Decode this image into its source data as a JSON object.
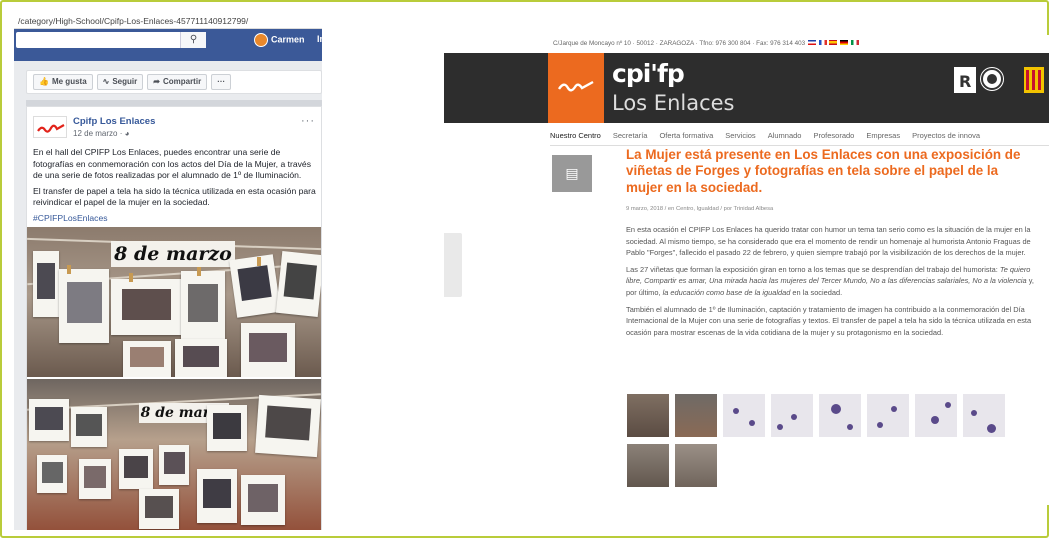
{
  "facebook": {
    "url": "/category/High-School/Cpifp-Los-Enlaces-457711140912799/",
    "search_icon": "search-icon",
    "user_name": "Carmen",
    "user_extra": "In",
    "buttons": {
      "like": "Me gusta",
      "follow": "Seguir",
      "share": "Compartir",
      "more": "···"
    },
    "post": {
      "page_name": "Cpifp Los Enlaces",
      "date": "12 de marzo · ",
      "more": "···",
      "paragraph1": "En el hall del CPIFP Los Enlaces, puedes encontrar una serie de fotografías en conmemoración con los actos del Día de la Mujer, a través de una serie de fotos realizadas por el alumnado de 1º de Iluminación.",
      "paragraph2": "El transfer de papel a tela ha sido la técnica utilizada en esta ocasión para reivindicar el papel de la mujer en la sociedad.",
      "hashtag": "#CPIFPLosEnlaces",
      "photo1_title": "8 de marzo",
      "photo2_title": "8 de marzo"
    }
  },
  "website": {
    "topbar": "C/Jarque de Moncayo nº 10 · 50012 · ZARAGOZA · Tfno: 976 300 804 · Fax: 976 314 403",
    "logo_name": "cpi'fp",
    "logo_sub": "Los Enlaces",
    "nav": [
      "Nuestro Centro",
      "Secretaría",
      "Oferta formativa",
      "Servicios",
      "Alumnado",
      "Profesorado",
      "Empresas",
      "Proyectos de innova"
    ],
    "article": {
      "title": "La Mujer está presente en Los Enlaces con una exposición de viñetas de Forges y fotografías en tela sobre el papel de la mujer en la sociedad.",
      "meta": "9 marzo, 2018 / en Centro, Igualdad / por Trinidad Albesa",
      "p1": "En esta ocasión el CPIFP Los Enlaces ha querido tratar con humor un tema tan serio como es la situación de la mujer en la sociedad. Al mismo tiempo, se ha considerado que era el momento de rendir un homenaje al humorista Antonio Fraguas de Pablo \"Forges\", fallecido el pasado 22 de febrero, y quien siempre trabajó por la visibilización de los derechos de la mujer.",
      "p2_start": "Las 27 viñetas que forman la exposición giran en torno a los temas que se desprendían del trabajo del humorista: ",
      "p2_italic": "Te quiero libre, Compartir es amar, Una mirada hacia las mujeres del Tercer Mundo, No a las diferencias salariales, No a la violencia",
      "p2_mid": " y, por último, ",
      "p2_italic2": "la educación como base de la igualdad",
      "p2_end": " en la sociedad.",
      "p3": "También el alumnado de 1º de Iluminación, captación y tratamiento de imagen ha contribuido a la conmemoración del Día Internacional de la Mujer con una serie de fotografías y textos. El transfer de papel a tela ha sido la técnica utilizada en esta ocasión para mostrar escenas de la vida cotidiana de la mujer  y su protagonismo en la sociedad."
    },
    "colors": {
      "accent": "#ec6a1f",
      "header_bg": "#2d2d2d",
      "facebook_blue": "#3b5998",
      "frame": "#b9cc3a"
    }
  }
}
